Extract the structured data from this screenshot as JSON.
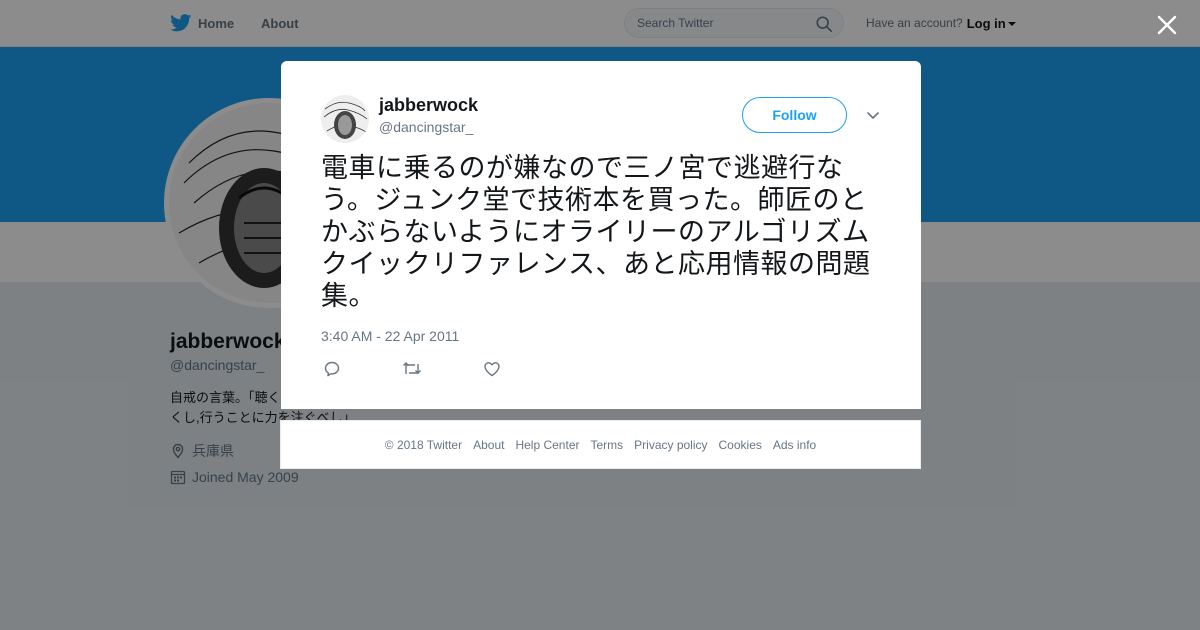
{
  "topnav": {
    "home_label": "Home",
    "about_label": "About",
    "search_placeholder": "Search Twitter",
    "account_prompt": "Have an account?",
    "login_label": "Log in"
  },
  "profile": {
    "name": "jabberwock",
    "handle": "@dancingstar_",
    "bio": "自戒の言葉。「聴くことを多くし,語ることを少なくし,行うことに力を注ぐべし」",
    "location": "兵庫県",
    "joined": "Joined May 2009"
  },
  "tweet": {
    "name": "jabberwock",
    "handle": "@dancingstar_",
    "follow_label": "Follow",
    "text": "電車に乗るのが嫌なので三ノ宮で逃避行なう。ジュンク堂で技術本を買った。師匠のとかぶらないようにオライリーのアルゴリズムクイックリファレンス、あと応用情報の問題集。",
    "timestamp": "3:40 AM - 22 Apr 2011"
  },
  "footer": {
    "copyright": "© 2018 Twitter",
    "links": [
      "About",
      "Help Center",
      "Terms",
      "Privacy policy",
      "Cookies",
      "Ads info"
    ]
  },
  "icons": {
    "logo": "twitter-bird-icon",
    "search": "search-icon",
    "close": "close-icon",
    "location": "location-pin-icon",
    "calendar": "calendar-icon",
    "more": "chevron-down-icon",
    "reply": "reply-icon",
    "retweet": "retweet-icon",
    "like": "heart-icon"
  },
  "colors": {
    "brand": "#1da1f2",
    "text": "#14171a",
    "secondary_text": "#657786"
  }
}
